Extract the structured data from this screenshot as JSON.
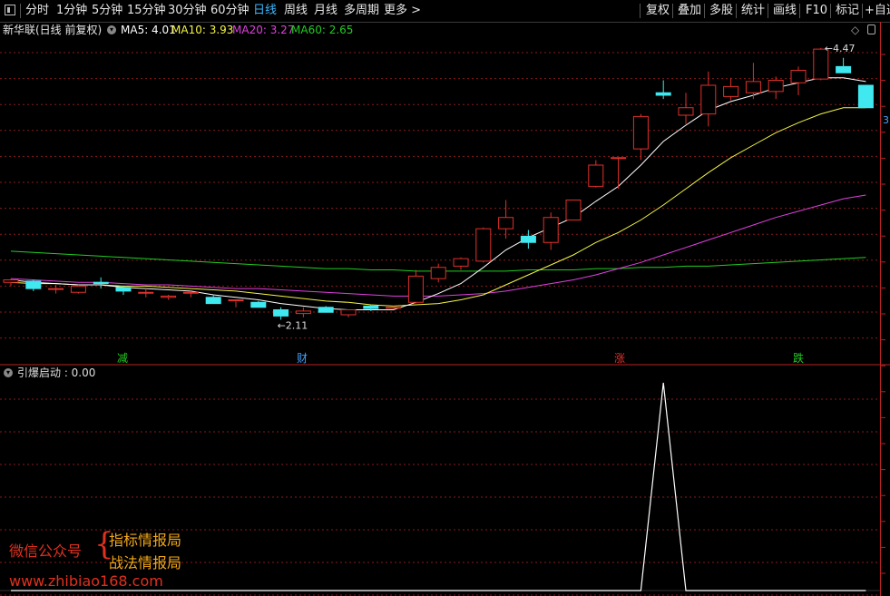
{
  "toolbar": {
    "periods": [
      "分时",
      "1分钟",
      "5分钟",
      "15分钟",
      "30分钟",
      "60分钟",
      "日线",
      "周线",
      "月线",
      "多周期",
      "更多 >"
    ],
    "active_period": "日线",
    "right_buttons": [
      "复权",
      "叠加",
      "多股",
      "统计",
      "画线",
      "F10",
      "标记",
      "+自选"
    ]
  },
  "header": {
    "stock_title": "新华联(日线 前复权)",
    "ma5": "MA5: 4.01",
    "ma10": "MA10: 3.93",
    "ma20": "MA20: 3.27",
    "ma60": "MA60: 2.65",
    "colors": {
      "ma5": "#ffffff",
      "ma10": "#f5f544",
      "ma20": "#e040e0",
      "ma60": "#22cc22",
      "up": "#e0302a",
      "down": "#40e8f0"
    }
  },
  "main_chart": {
    "high_label": "4.47",
    "low_label": "2.11",
    "axis_tag": "3",
    "event_markers": [
      {
        "label": "减",
        "color": "#22cc22"
      },
      {
        "label": "财",
        "color": "#40a0ff"
      },
      {
        "label": "涨",
        "color": "#e0302a"
      },
      {
        "label": "跌",
        "color": "#22cc22"
      }
    ]
  },
  "indicator": {
    "title": "引爆启动 : 0.00"
  },
  "watermark": {
    "line1": "微信公众号",
    "brace": "{",
    "line2": "指标情报局",
    "line3": "战法情报局",
    "url": "www.zhibiao168.com"
  },
  "chart_data": {
    "type": "candlestick",
    "candles": [
      {
        "o": 2.6,
        "h": 2.63,
        "l": 2.57,
        "c": 2.62
      },
      {
        "o": 2.61,
        "h": 2.62,
        "l": 2.53,
        "c": 2.55
      },
      {
        "o": 2.55,
        "h": 2.58,
        "l": 2.51,
        "c": 2.55
      },
      {
        "o": 2.52,
        "h": 2.58,
        "l": 2.51,
        "c": 2.57
      },
      {
        "o": 2.6,
        "h": 2.64,
        "l": 2.55,
        "c": 2.59
      },
      {
        "o": 2.56,
        "h": 2.57,
        "l": 2.5,
        "c": 2.53
      },
      {
        "o": 2.52,
        "h": 2.55,
        "l": 2.48,
        "c": 2.52
      },
      {
        "o": 2.48,
        "h": 2.5,
        "l": 2.46,
        "c": 2.49
      },
      {
        "o": 2.52,
        "h": 2.53,
        "l": 2.48,
        "c": 2.52
      },
      {
        "o": 2.48,
        "h": 2.5,
        "l": 2.43,
        "c": 2.43
      },
      {
        "o": 2.46,
        "h": 2.46,
        "l": 2.4,
        "c": 2.46
      },
      {
        "o": 2.44,
        "h": 2.45,
        "l": 2.4,
        "c": 2.4
      },
      {
        "o": 2.38,
        "h": 2.4,
        "l": 2.3,
        "c": 2.33
      },
      {
        "o": 2.35,
        "h": 2.4,
        "l": 2.32,
        "c": 2.37
      },
      {
        "o": 2.4,
        "h": 2.41,
        "l": 2.36,
        "c": 2.36
      },
      {
        "o": 2.34,
        "h": 2.38,
        "l": 2.32,
        "c": 2.38
      },
      {
        "o": 2.41,
        "h": 2.42,
        "l": 2.37,
        "c": 2.39
      },
      {
        "o": 2.4,
        "h": 2.41,
        "l": 2.39,
        "c": 2.4
      },
      {
        "o": 2.44,
        "h": 2.7,
        "l": 2.43,
        "c": 2.65
      },
      {
        "o": 2.63,
        "h": 2.75,
        "l": 2.6,
        "c": 2.72
      },
      {
        "o": 2.73,
        "h": 2.8,
        "l": 2.7,
        "c": 2.79
      },
      {
        "o": 2.77,
        "h": 3.04,
        "l": 2.76,
        "c": 3.03
      },
      {
        "o": 3.03,
        "h": 3.26,
        "l": 2.95,
        "c": 3.12
      },
      {
        "o": 2.97,
        "h": 3.02,
        "l": 2.87,
        "c": 2.92
      },
      {
        "o": 2.92,
        "h": 3.16,
        "l": 2.86,
        "c": 3.12
      },
      {
        "o": 3.1,
        "h": 3.15,
        "l": 3.1,
        "c": 3.26
      },
      {
        "o": 3.37,
        "h": 3.58,
        "l": 3.36,
        "c": 3.54
      },
      {
        "o": 3.6,
        "h": 3.6,
        "l": 3.35,
        "c": 3.6
      },
      {
        "o": 3.67,
        "h": 3.95,
        "l": 3.58,
        "c": 3.93
      },
      {
        "o": 4.12,
        "h": 4.22,
        "l": 4.07,
        "c": 4.1
      },
      {
        "o": 3.94,
        "h": 4.12,
        "l": 3.87,
        "c": 4.0
      },
      {
        "o": 3.95,
        "h": 4.29,
        "l": 3.85,
        "c": 4.18
      },
      {
        "o": 4.09,
        "h": 4.24,
        "l": 4.06,
        "c": 4.17
      },
      {
        "o": 4.12,
        "h": 4.36,
        "l": 4.07,
        "c": 4.21
      },
      {
        "o": 4.13,
        "h": 4.25,
        "l": 4.07,
        "c": 4.22
      },
      {
        "o": 4.2,
        "h": 4.33,
        "l": 4.1,
        "c": 4.3
      },
      {
        "o": 4.23,
        "h": 4.48,
        "l": 4.22,
        "c": 4.47
      },
      {
        "o": 4.33,
        "h": 4.4,
        "l": 4.32,
        "c": 4.28
      },
      {
        "o": 4.18,
        "h": 4.18,
        "l": 4.02,
        "c": 4.0
      }
    ],
    "ma5": [
      2.62,
      2.6,
      2.59,
      2.58,
      2.58,
      2.56,
      2.55,
      2.54,
      2.53,
      2.5,
      2.48,
      2.46,
      2.43,
      2.41,
      2.39,
      2.38,
      2.38,
      2.38,
      2.44,
      2.51,
      2.59,
      2.72,
      2.86,
      2.96,
      3.04,
      3.12,
      3.25,
      3.37,
      3.54,
      3.73,
      3.86,
      3.98,
      4.05,
      4.1,
      4.16,
      4.2,
      4.24,
      4.24,
      4.21
    ],
    "ma10": [
      2.6,
      2.59,
      2.59,
      2.58,
      2.58,
      2.57,
      2.57,
      2.56,
      2.55,
      2.54,
      2.53,
      2.51,
      2.49,
      2.47,
      2.45,
      2.44,
      2.42,
      2.41,
      2.42,
      2.43,
      2.46,
      2.5,
      2.58,
      2.66,
      2.74,
      2.82,
      2.92,
      3.0,
      3.1,
      3.22,
      3.35,
      3.48,
      3.6,
      3.7,
      3.8,
      3.88,
      3.95,
      4.0,
      4.0
    ],
    "ma20": [
      2.63,
      2.62,
      2.61,
      2.6,
      2.6,
      2.59,
      2.58,
      2.58,
      2.57,
      2.56,
      2.55,
      2.55,
      2.54,
      2.53,
      2.52,
      2.51,
      2.5,
      2.49,
      2.49,
      2.49,
      2.5,
      2.51,
      2.53,
      2.56,
      2.59,
      2.62,
      2.66,
      2.71,
      2.76,
      2.82,
      2.88,
      2.94,
      3.0,
      3.06,
      3.12,
      3.17,
      3.22,
      3.27,
      3.3
    ],
    "ma60": [
      2.85,
      2.84,
      2.83,
      2.82,
      2.81,
      2.8,
      2.79,
      2.78,
      2.77,
      2.76,
      2.75,
      2.74,
      2.73,
      2.72,
      2.71,
      2.71,
      2.7,
      2.7,
      2.69,
      2.69,
      2.69,
      2.69,
      2.69,
      2.7,
      2.7,
      2.7,
      2.71,
      2.71,
      2.72,
      2.72,
      2.73,
      2.73,
      2.74,
      2.75,
      2.76,
      2.77,
      2.78,
      2.79,
      2.8
    ],
    "indicator_values": [
      0,
      0,
      0,
      0,
      0,
      0,
      0,
      0,
      0,
      0,
      0,
      0,
      0,
      0,
      0,
      0,
      0,
      0,
      0,
      0,
      0,
      0,
      0,
      0,
      0,
      0,
      0,
      0,
      0,
      1,
      0,
      0,
      0,
      0,
      0,
      0,
      0,
      0,
      0
    ],
    "ylim": [
      2.1,
      4.5
    ]
  }
}
